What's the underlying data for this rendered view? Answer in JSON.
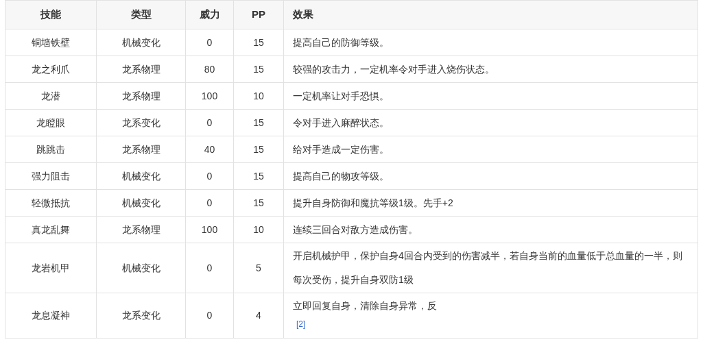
{
  "table": {
    "columns": [
      "技能",
      "类型",
      "威力",
      "PP",
      "效果"
    ],
    "rows": [
      {
        "cells": [
          "铜墙铁壁",
          "机械变化",
          "0",
          "15",
          "提高自己的防御等级。"
        ]
      },
      {
        "cells": [
          "龙之利爪",
          "龙系物理",
          "80",
          "15",
          "较强的攻击力，一定机率令对手进入烧伤状态。"
        ]
      },
      {
        "cells": [
          "龙潜",
          "龙系物理",
          "100",
          "10",
          "一定机率让对手恐惧。"
        ]
      },
      {
        "cells": [
          "龙瞪眼",
          "龙系变化",
          "0",
          "15",
          "令对手进入麻醉状态。"
        ]
      },
      {
        "cells": [
          "跳跳击",
          "龙系物理",
          "40",
          "15",
          "给对手造成一定伤害。"
        ]
      },
      {
        "cells": [
          "强力阻击",
          "机械变化",
          "0",
          "15",
          "提高自己的物攻等级。"
        ]
      },
      {
        "cells": [
          "轻微抵抗",
          "机械变化",
          "0",
          "15",
          "提升自身防御和魔抗等级1级。先手+2"
        ]
      },
      {
        "cells": [
          "真龙乱舞",
          "龙系物理",
          "100",
          "10",
          "连续三回合对敌方造成伤害。"
        ]
      },
      {
        "cells": [
          "龙岩机甲",
          "机械变化",
          "0",
          "5",
          "开启机械护甲，保护自身4回合内受到的伤害减半，若自身当前的血量低于总血量的一半，则每次受伤，提升自身双防1级"
        ]
      },
      {
        "cells": [
          "龙息凝神",
          "龙系变化",
          "0",
          "4",
          "立即回复自身，清除自身异常，反"
        ],
        "footnote": "[2]"
      }
    ]
  }
}
